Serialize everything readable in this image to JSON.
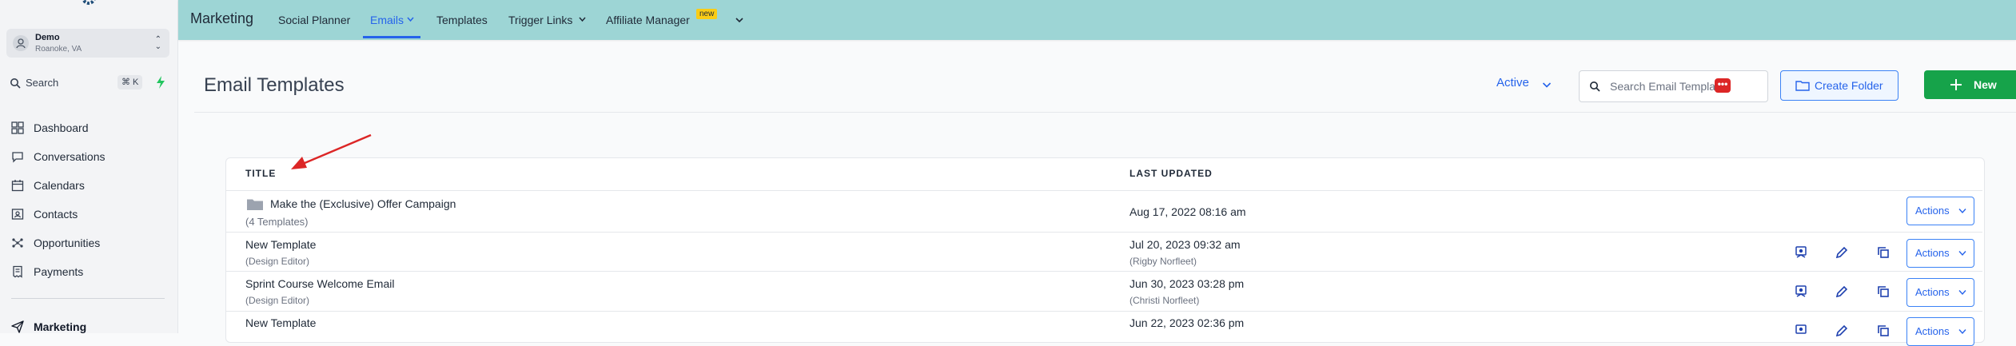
{
  "colors": {
    "topbar": "#9dd5d5",
    "accent": "#2563eb",
    "new_button": "#16a34a",
    "badge": "#facc15",
    "annotation_arrow": "#dc2626"
  },
  "sidebar": {
    "account": {
      "name": "Demo",
      "location": "Roanoke, VA"
    },
    "search": {
      "label": "Search",
      "shortcut": "⌘ K"
    },
    "items": [
      {
        "label": "Dashboard",
        "icon": "dashboard-icon"
      },
      {
        "label": "Conversations",
        "icon": "chat-bubble-icon"
      },
      {
        "label": "Calendars",
        "icon": "calendar-icon"
      },
      {
        "label": "Contacts",
        "icon": "contact-card-icon"
      },
      {
        "label": "Opportunities",
        "icon": "funnel-icon"
      },
      {
        "label": "Payments",
        "icon": "receipt-icon"
      },
      {
        "label": "Marketing",
        "icon": "paper-plane-icon",
        "active": true
      }
    ]
  },
  "topbar": {
    "title": "Marketing",
    "tabs": [
      {
        "label": "Social Planner"
      },
      {
        "label": "Emails",
        "active": true
      },
      {
        "label": "Templates"
      },
      {
        "label": "Trigger Links"
      },
      {
        "label": "Affiliate Manager"
      }
    ],
    "new_badge": "new"
  },
  "header": {
    "title": "Email Templates",
    "status_filter": "Active",
    "search_placeholder": "Search Email Templates",
    "create_folder": "Create Folder",
    "new": "New"
  },
  "table": {
    "columns": [
      "TITLE",
      "LAST UPDATED"
    ],
    "actions_label": "Actions",
    "rows": [
      {
        "title": "Make the (Exclusive) Offer Campaign",
        "subtitle": "(4 Templates)",
        "updated": "Aug 17, 2022 08:16 am",
        "updated_by": "",
        "is_folder": true
      },
      {
        "title": "New Template",
        "subtitle": "(Design Editor)",
        "updated": "Jul 20, 2023 09:32 am",
        "updated_by": "(Rigby Norfleet)"
      },
      {
        "title": "Sprint Course Welcome Email",
        "subtitle": "(Design Editor)",
        "updated": "Jun 30, 2023 03:28 pm",
        "updated_by": "(Christi Norfleet)"
      },
      {
        "title": "New Template",
        "subtitle": "",
        "updated": "Jun 22, 2023 02:36 pm",
        "updated_by": ""
      }
    ]
  }
}
